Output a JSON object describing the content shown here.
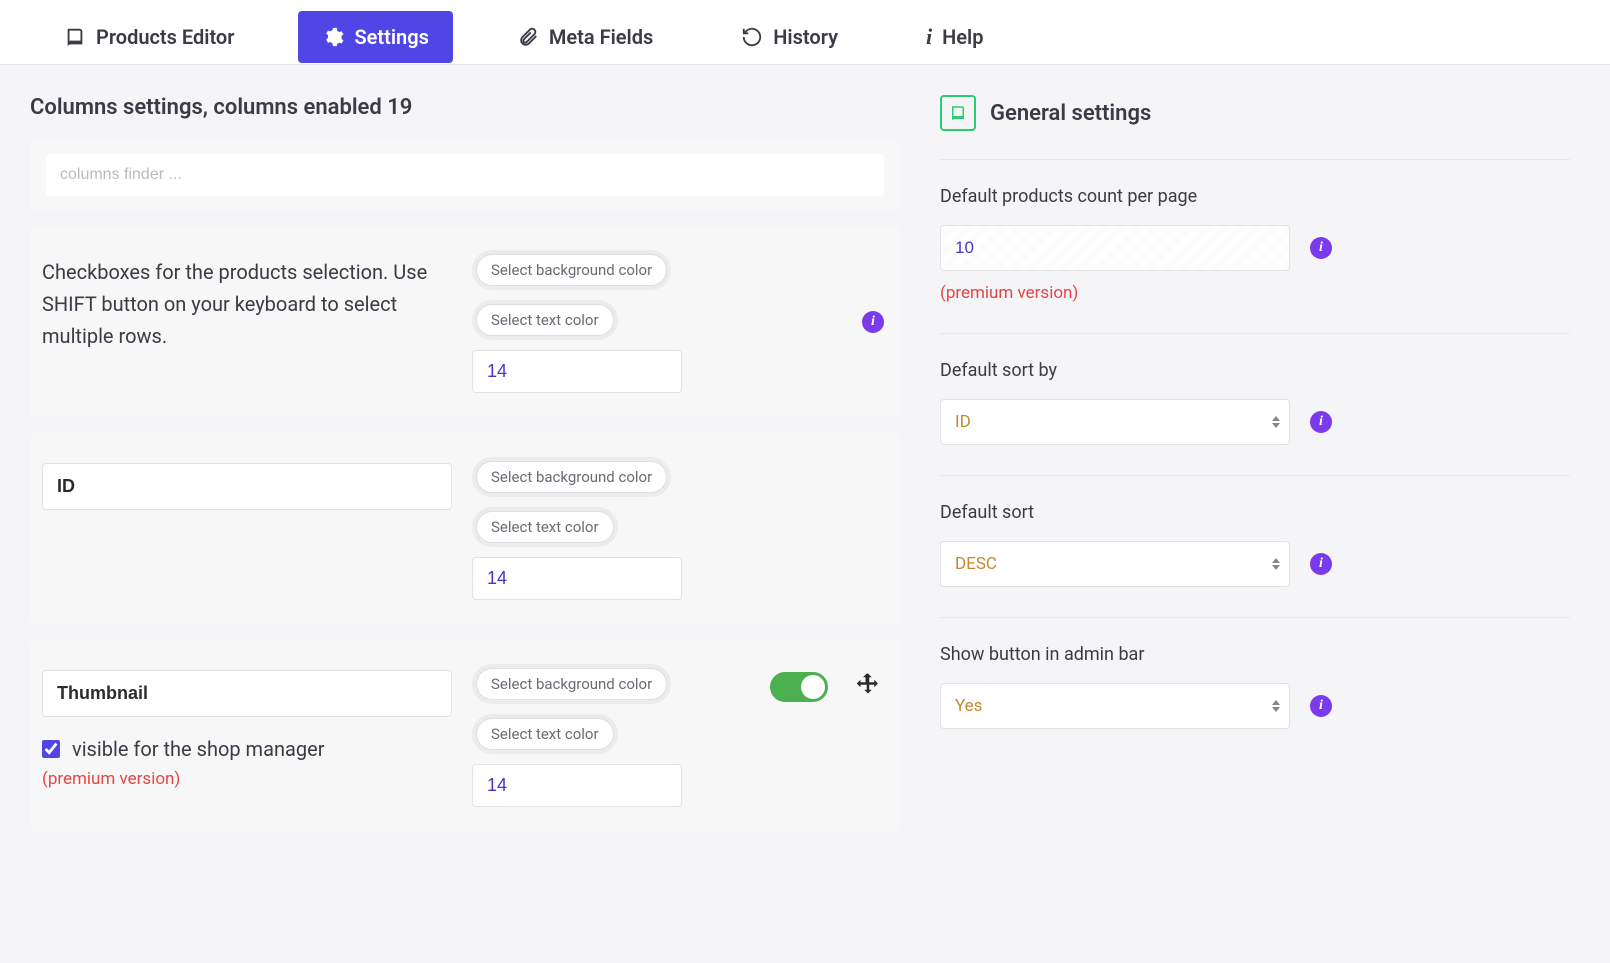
{
  "tabs": [
    {
      "label": "Products Editor",
      "icon": "book-icon"
    },
    {
      "label": "Settings",
      "icon": "gear-icon",
      "active": true
    },
    {
      "label": "Meta Fields",
      "icon": "paperclip-icon"
    },
    {
      "label": "History",
      "icon": "undo-icon"
    },
    {
      "label": "Help",
      "icon": "info-icon"
    }
  ],
  "columns_section": {
    "title_prefix": "Columns settings, columns enabled",
    "enabled_count": "19",
    "finder_placeholder": "columns finder ...",
    "rows": [
      {
        "description": "Checkboxes for the products selection. Use SHIFT button on your keyboard to select multiple rows.",
        "bg_btn": "Select background color",
        "txt_btn": "Select text color",
        "fontsize": "14",
        "show_info_right": true
      },
      {
        "name": "ID",
        "bg_btn": "Select background color",
        "txt_btn": "Select text color",
        "fontsize": "14"
      },
      {
        "name": "Thumbnail",
        "bg_btn": "Select background color",
        "txt_btn": "Select text color",
        "fontsize": "14",
        "show_toggle": true,
        "show_drag": true,
        "visible_label": "visible for the shop manager",
        "premium_text": "(premium version)"
      }
    ]
  },
  "general": {
    "title": "General settings",
    "settings": [
      {
        "label": "Default products count per page",
        "value": "10",
        "type": "input",
        "premium": "(premium version)"
      },
      {
        "label": "Default sort by",
        "value": "ID",
        "type": "select"
      },
      {
        "label": "Default sort",
        "value": "DESC",
        "type": "select"
      },
      {
        "label": "Show button in admin bar",
        "value": "Yes",
        "type": "select"
      }
    ]
  }
}
